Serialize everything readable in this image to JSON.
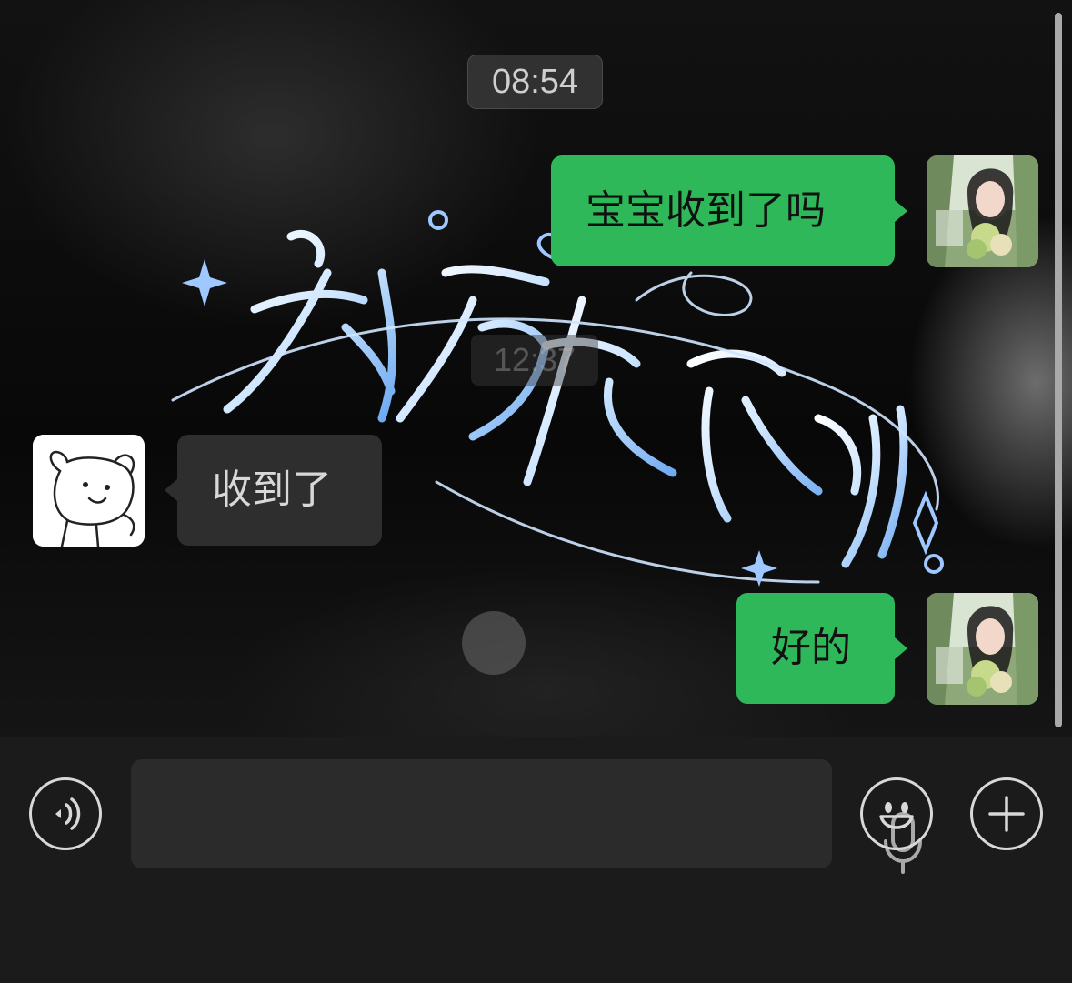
{
  "chat": {
    "timestamp": "08:54",
    "ghost_timestamp": "12:37",
    "messages": [
      {
        "side": "right",
        "text": "宝宝收到了吗"
      },
      {
        "side": "left",
        "text": "收到了"
      },
      {
        "side": "right",
        "text": "好的"
      }
    ],
    "wallpaper_title": "初夏夜南风"
  },
  "input": {
    "voice_icon": "voice-icon",
    "mic_icon": "microphone-icon",
    "emoji_icon": "emoji-icon",
    "more_icon": "plus-icon"
  },
  "colors": {
    "sent_bubble": "#2fb85a",
    "received_bubble": "#2e2e2e",
    "background": "#0c0c0c"
  }
}
